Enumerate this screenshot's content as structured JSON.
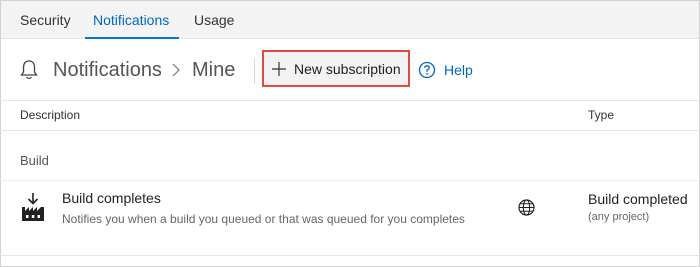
{
  "tabs": [
    {
      "label": "Security",
      "active": false
    },
    {
      "label": "Notifications",
      "active": true
    },
    {
      "label": "Usage",
      "active": false
    }
  ],
  "breadcrumb": {
    "icon": "bell-icon",
    "root": "Notifications",
    "separator": "chevron-right-icon",
    "current": "Mine"
  },
  "toolbar": {
    "new_subscription": {
      "label": "New subscription",
      "icon": "plus-icon",
      "highlighted": true,
      "highlight_color": "#e04a3f"
    },
    "help": {
      "label": "Help",
      "icon": "help-circle-icon"
    }
  },
  "table": {
    "columns": [
      "Description",
      "Type"
    ],
    "groups": [
      {
        "name": "Build",
        "rows": [
          {
            "icon": "build-icon",
            "title": "Build completes",
            "description": "Notifies you when a build you queued or that was queued for you completes",
            "scope_icon": "globe-icon",
            "type": "Build completed",
            "type_detail": "(any project)"
          }
        ]
      }
    ]
  },
  "colors": {
    "accent": "#0078d4",
    "link": "#0066c4",
    "tab_bar": "#f4f4f4"
  }
}
